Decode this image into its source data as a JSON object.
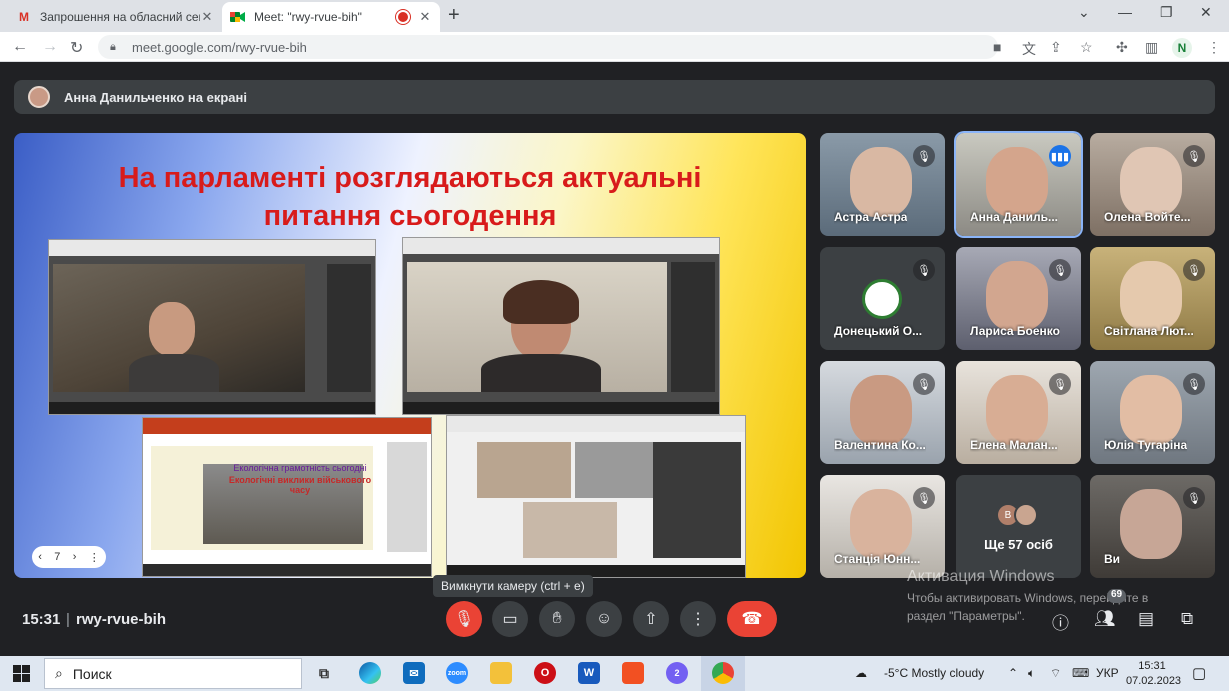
{
  "browser": {
    "tabs": [
      {
        "title": "Запрошення на обласний семін",
        "favicon": "gmail-icon"
      },
      {
        "title": "Meet: \"rwy-rvue-bih\"",
        "favicon": "meet-icon",
        "recording": true
      }
    ],
    "url": "meet.google.com/rwy-rvue-bih",
    "profile_initial": "N"
  },
  "meet": {
    "presenter_banner": "Анна Данильченко на екрані",
    "slide": {
      "title_line1": "На парламенті розглядаються актуальні",
      "title_line2": "питання сьогодення",
      "inner_text1": "Екологічна грамотність сьогодні",
      "inner_text2": "Екологічні виклики військового часу",
      "page": "7"
    },
    "participants": [
      {
        "name": "Астра Астра",
        "muted": true
      },
      {
        "name": "Анна Даниль...",
        "speaking": true
      },
      {
        "name": "Олена Войте...",
        "muted": true
      },
      {
        "name": "Донецький О...",
        "muted": true
      },
      {
        "name": "Лариса Боенко",
        "muted": true
      },
      {
        "name": "Світлана Лют...",
        "muted": true
      },
      {
        "name": "Валентина Ко...",
        "muted": true
      },
      {
        "name": "Елена Малан...",
        "muted": true
      },
      {
        "name": "Юлія Тугаріна",
        "muted": true
      },
      {
        "name": "Станція Юнн...",
        "muted": true
      },
      {
        "more": "Ще 57 осіб",
        "avatar_letter": "В"
      },
      {
        "name": "Ви",
        "muted": true
      }
    ],
    "tooltip": "Вимкнути камеру (ctrl + e)",
    "time": "15:31",
    "separator": "|",
    "meeting_code": "rwy-rvue-bih",
    "people_count": "69",
    "watermark": {
      "line1": "Активация Windows",
      "line2": "Чтобы активировать Windows, перейдите в",
      "line3": "раздел \"Параметры\"."
    },
    "colors": {
      "red": "#ea4335",
      "surface": "#202124",
      "button": "#3c4043",
      "accent": "#1a73e8"
    }
  },
  "taskbar": {
    "search_placeholder": "Поиск",
    "weather": "-5°C  Mostly cloudy",
    "language": "УКР",
    "clock_time": "15:31",
    "clock_date": "07.02.2023",
    "viber_badge": "2"
  }
}
